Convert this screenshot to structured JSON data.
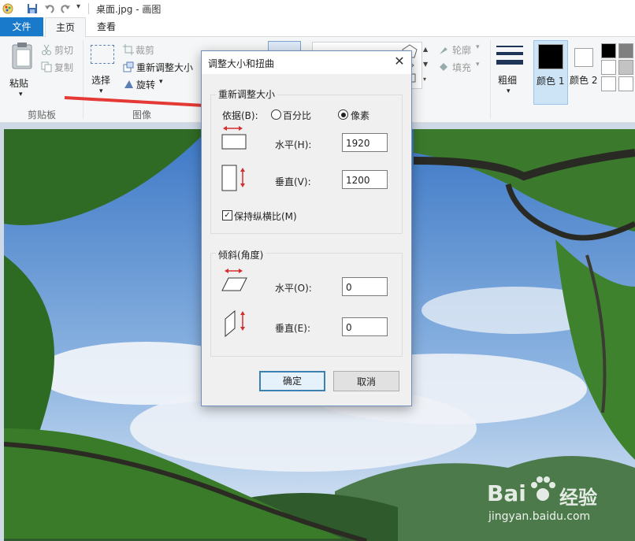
{
  "window": {
    "title": "桌面.jpg - 画图"
  },
  "tabs": [
    {
      "label": "文件"
    },
    {
      "label": "主页"
    },
    {
      "label": "查看"
    }
  ],
  "ribbon": {
    "clipboard": {
      "paste": "粘贴",
      "cut": "剪切",
      "copy": "复制",
      "group": "剪贴板"
    },
    "image": {
      "select": "选择",
      "crop": "裁剪",
      "resize": "重新调整大小",
      "rotate": "旋转",
      "group": "图像"
    },
    "shapes": {
      "outline": "轮廓",
      "fill": "填充"
    },
    "size": {
      "label": "粗细"
    },
    "colors": {
      "color1": "颜色 1",
      "color2": "颜色 2",
      "color1_value": "#000000",
      "color2_value": "#ffffff"
    }
  },
  "dialog": {
    "title": "调整大小和扭曲",
    "resize": {
      "legend": "重新调整大小",
      "by_label": "依据(B):",
      "percent_label": "百分比",
      "pixels_label": "像素",
      "selected": "pixels",
      "horizontal_label": "水平(H):",
      "horizontal_value": "1920",
      "vertical_label": "垂直(V):",
      "vertical_value": "1200",
      "keep_ratio_label": "保持纵横比(M)",
      "keep_ratio_checked": true
    },
    "skew": {
      "legend": "倾斜(角度)",
      "horizontal_label": "水平(O):",
      "horizontal_value": "0",
      "vertical_label": "垂直(E):",
      "vertical_value": "0"
    },
    "ok_label": "确定",
    "cancel_label": "取消"
  },
  "watermark": {
    "brand": "Bai",
    "brand2": "经验",
    "url": "jingyan.baidu.com"
  },
  "accent": "#1979ca",
  "annotation_arrow_color": "#e53935"
}
